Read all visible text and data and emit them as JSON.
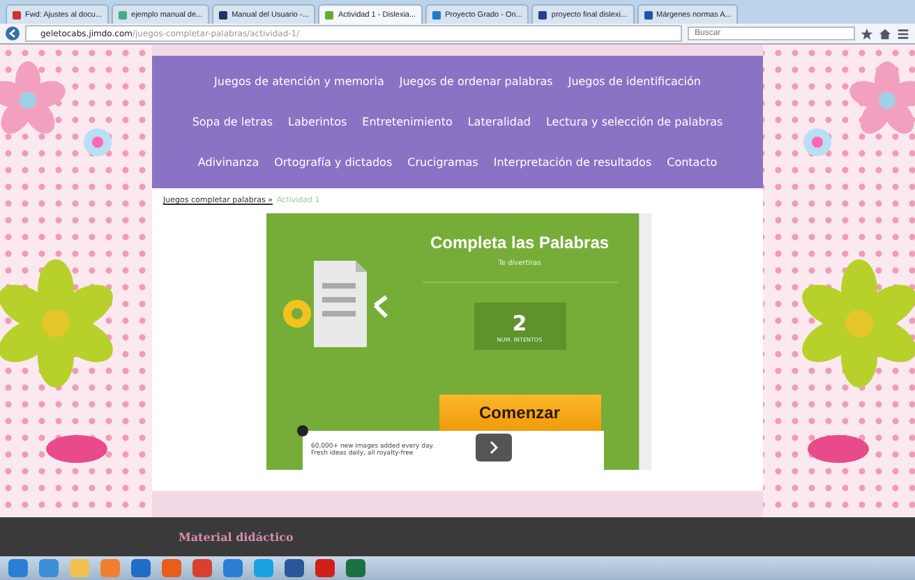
{
  "browser": {
    "tabs": [
      {
        "label": "Fwd: Ajustes al docu...",
        "selected": false
      },
      {
        "label": "ejemplo manual de...",
        "selected": false
      },
      {
        "label": "Manual del Usuario -...",
        "selected": false
      },
      {
        "label": "Actividad 1 - Dislexia...",
        "selected": true
      },
      {
        "label": "Proyecto Grado - On...",
        "selected": false
      },
      {
        "label": "proyecto final dislexi...",
        "selected": false
      },
      {
        "label": "Márgenes normas A...",
        "selected": false
      }
    ],
    "address": {
      "domain": "geletocabs.jimdo.com",
      "path": "/juegos-completar-palabras/actividad-1/"
    },
    "search": {
      "placeholder": "Buscar"
    }
  },
  "nav": {
    "rows": [
      {
        "links": [
          "Juegos de atención y memoria",
          "Juegos de ordenar palabras",
          "Juegos de identificación"
        ]
      },
      {
        "links": [
          "Sopa de letras",
          "Laberintos",
          "Entretenimiento",
          "Lateralidad",
          "Lectura y selección de palabras"
        ]
      },
      {
        "links": [
          "Adivinanza",
          "Ortografía y dictados",
          "Crucigramas",
          "Interpretación de resultados",
          "Contacto"
        ]
      }
    ]
  },
  "breadcrumb": {
    "parent": "Juegos completar palabras »",
    "current": "Actividad 1"
  },
  "game": {
    "title": "Completa las Palabras",
    "subtitle": "Te divertiras",
    "attempts": "2",
    "attempts_label": "NUM. INTENTOS",
    "start": "Comenzar"
  },
  "ad": {
    "lines": [
      "60,000+ new images added every day.",
      "Fresh ideas daily, all royalty-free"
    ]
  },
  "footer": {
    "label": "Material didáctico"
  }
}
